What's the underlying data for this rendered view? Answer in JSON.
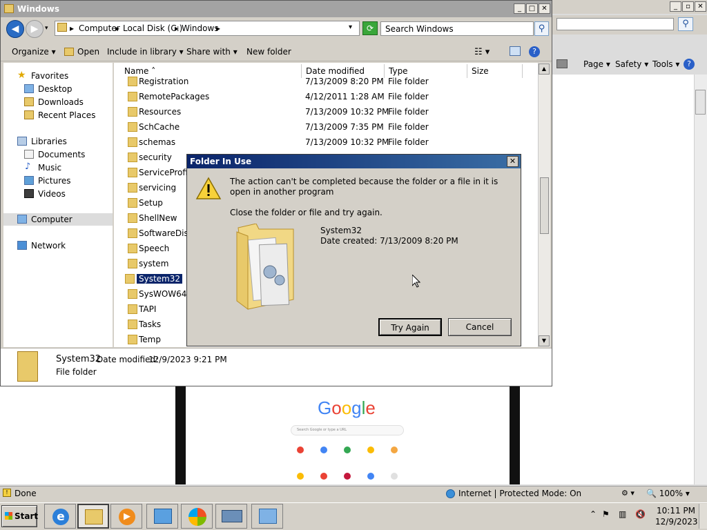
{
  "explorer": {
    "title": "Windows",
    "breadcrumb": [
      "Computer",
      "Local Disk (C:)",
      "Windows"
    ],
    "search_placeholder": "Search Windows",
    "toolbar": {
      "organize": "Organize",
      "open": "Open",
      "include_in_library": "Include in library",
      "share_with": "Share with",
      "new_folder": "New folder"
    },
    "nav": {
      "favorites": "Favorites",
      "desktop": "Desktop",
      "downloads": "Downloads",
      "recent_places": "Recent Places",
      "libraries": "Libraries",
      "documents": "Documents",
      "music": "Music",
      "pictures": "Pictures",
      "videos": "Videos",
      "computer": "Computer",
      "network": "Network"
    },
    "columns": [
      "Name",
      "Date modified",
      "Type",
      "Size"
    ],
    "files": [
      {
        "name": "Registration",
        "date": "7/13/2009 8:20 PM",
        "type": "File folder"
      },
      {
        "name": "RemotePackages",
        "date": "4/12/2011 1:28 AM",
        "type": "File folder"
      },
      {
        "name": "Resources",
        "date": "7/13/2009 10:32 PM",
        "type": "File folder"
      },
      {
        "name": "SchCache",
        "date": "7/13/2009 7:35 PM",
        "type": "File folder"
      },
      {
        "name": "schemas",
        "date": "7/13/2009 10:32 PM",
        "type": "File folder"
      },
      {
        "name": "security",
        "date": "",
        "type": ""
      },
      {
        "name": "ServiceProfiles",
        "date": "",
        "type": ""
      },
      {
        "name": "servicing",
        "date": "",
        "type": ""
      },
      {
        "name": "Setup",
        "date": "",
        "type": ""
      },
      {
        "name": "ShellNew",
        "date": "",
        "type": ""
      },
      {
        "name": "SoftwareDistri",
        "date": "",
        "type": ""
      },
      {
        "name": "Speech",
        "date": "",
        "type": ""
      },
      {
        "name": "system",
        "date": "",
        "type": ""
      },
      {
        "name": "System32",
        "date": "",
        "type": ""
      },
      {
        "name": "SysWOW64",
        "date": "",
        "type": ""
      },
      {
        "name": "TAPI",
        "date": "",
        "type": ""
      },
      {
        "name": "Tasks",
        "date": "",
        "type": ""
      },
      {
        "name": "Temp",
        "date": "",
        "type": ""
      }
    ],
    "details": {
      "name": "System32",
      "modified_label": "Date modified:",
      "modified_value": "12/9/2023 9:21 PM",
      "type": "File folder"
    }
  },
  "dialog": {
    "title": "Folder In Use",
    "message": "The action can't be completed because the folder or a file in it is open in another program",
    "hint": "Close the folder or file and try again.",
    "file_name": "System32",
    "date_created": "Date created: 7/13/2009 8:20 PM",
    "try_again": "Try Again",
    "cancel": "Cancel"
  },
  "ie": {
    "commands": {
      "page": "Page",
      "safety": "Safety",
      "tools": "Tools"
    },
    "status_done": "Done",
    "zone": "Internet | Protected Mode: On",
    "zoom": "100%",
    "google": "Google",
    "google_search_placeholder": "Search Google or type a URL"
  },
  "taskbar": {
    "start": "Start",
    "time": "10:11 PM",
    "date": "12/9/2023"
  }
}
